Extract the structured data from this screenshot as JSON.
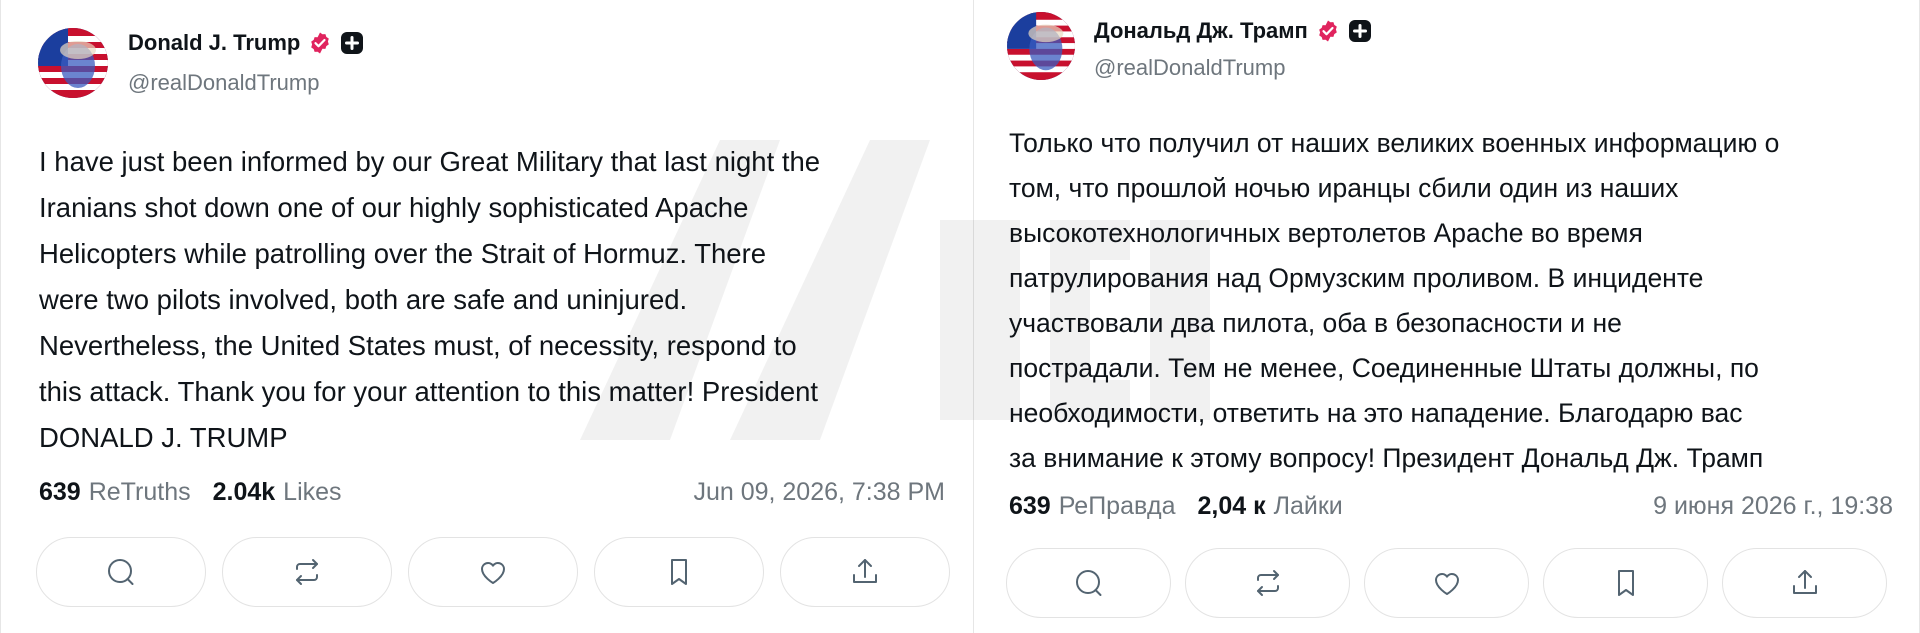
{
  "colors": {
    "verified_badge": "#e0245e",
    "text_primary": "#0f1419",
    "text_secondary": "#6e767d",
    "button_border": "#e3e3e3",
    "avatar_blue": "#1b3e9e",
    "avatar_red": "#c8102e"
  },
  "posts": [
    {
      "display_name": "Donald J. Trump",
      "handle": "@realDonaldTrump",
      "text": "I have just been informed by our Great Military that last night the\nIranians shot down one of our highly sophisticated Apache\nHelicopters while patrolling over the Strait of Hormuz. There\nwere two pilots involved, both are safe and uninjured.\nNevertheless, the United States must, of necessity, respond to\nthis attack. Thank you for your attention to this matter! President\nDONALD J. TRUMP",
      "retruths_count": "639",
      "retruths_label": "ReTruths",
      "likes_count": "2.04k",
      "likes_label": "Likes",
      "timestamp": "Jun 09, 2026, 7:38 PM",
      "icons": [
        "verified-badge-icon",
        "plus-badge-icon",
        "reply-icon",
        "retruth-icon",
        "like-icon",
        "bookmark-icon",
        "share-icon"
      ]
    },
    {
      "display_name": "Дональд Дж. Трамп",
      "handle": "@realDonaldTrump",
      "text": "Только что получил от наших великих военных информацию о\nтом, что прошлой ночью иранцы сбили один из наших\nвысокотехнологичных вертолетов Apache во время\nпатрулирования над Ормузским проливом. В инциденте\nучаствовали два пилота, оба в безопасности и не\nпострадали. Тем не менее, Соединенные Штаты должны, по\nнеобходимости, ответить на это нападение. Благодарю вас\nза внимание к этому вопросу! Президент Дональд Дж. Трамп",
      "retruths_count": "639",
      "retruths_label": "РеПравда",
      "likes_count": "2,04 к",
      "likes_label": "Лайки",
      "timestamp": "9 июня 2026 г., 19:38",
      "icons": [
        "verified-badge-icon",
        "plus-badge-icon",
        "reply-icon",
        "retruth-icon",
        "like-icon",
        "bookmark-icon",
        "share-icon"
      ]
    }
  ]
}
